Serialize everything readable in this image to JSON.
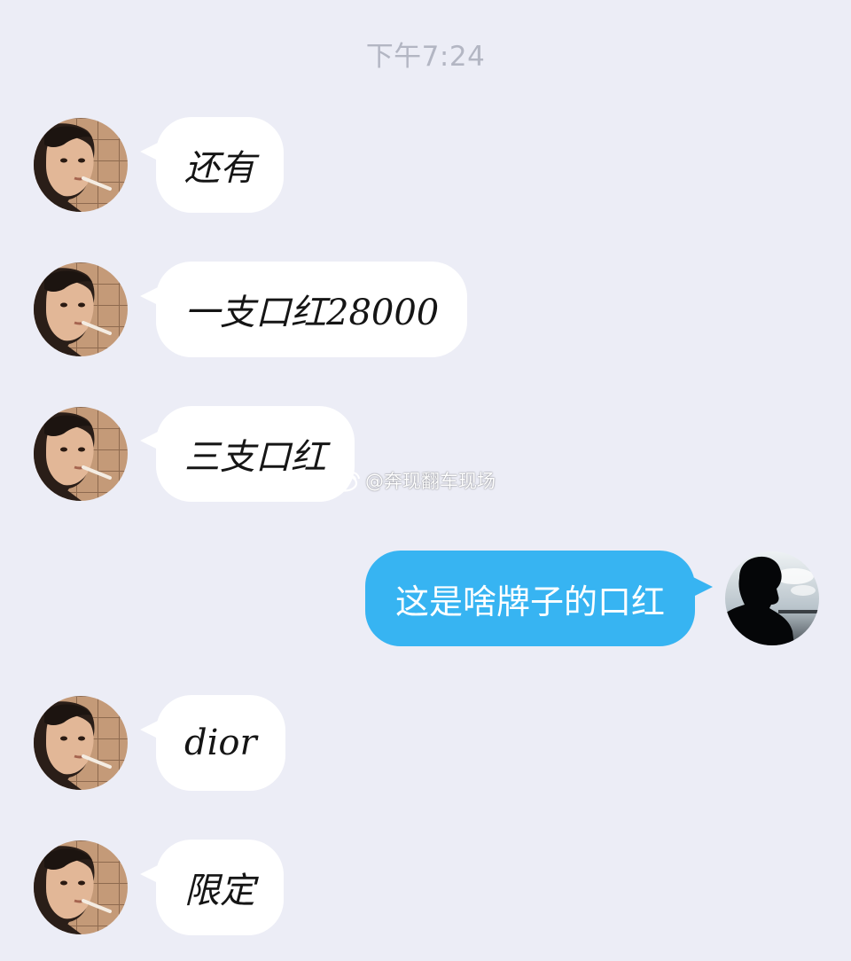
{
  "timestamp": "下午7:24",
  "messages": [
    {
      "direction": "incoming",
      "text": "还有"
    },
    {
      "direction": "incoming",
      "text": "一支口红28000"
    },
    {
      "direction": "incoming",
      "text": "三支口红"
    },
    {
      "direction": "outgoing",
      "text": "这是啥牌子的口红"
    },
    {
      "direction": "incoming",
      "text": "dior"
    },
    {
      "direction": "incoming",
      "text": "限定"
    }
  ],
  "watermark": {
    "text": "@奔现翻车现场",
    "icon": "weibo-icon"
  },
  "colors": {
    "background": "#ecedf6",
    "incoming_bubble": "#ffffff",
    "outgoing_bubble": "#37b4f2",
    "timestamp": "#b3b6c3"
  }
}
